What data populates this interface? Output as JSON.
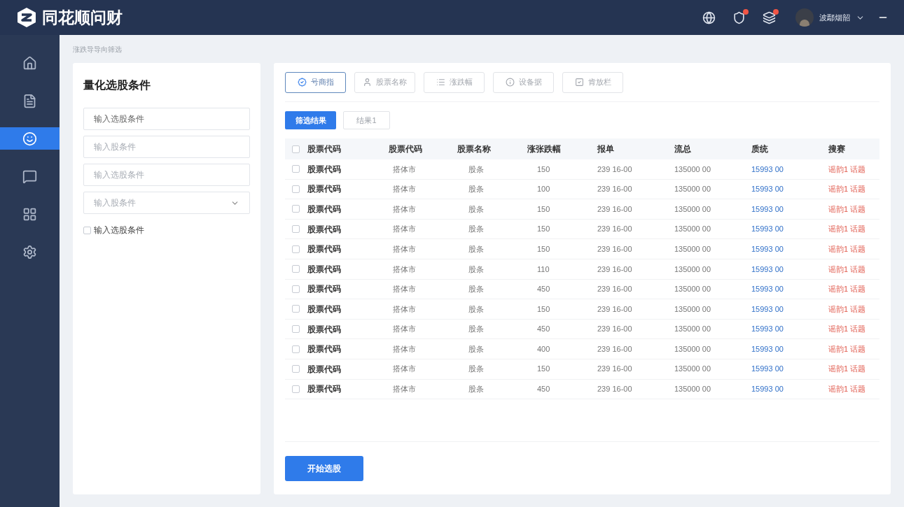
{
  "header": {
    "brand": "同花顺问财",
    "user": "波鄢烟韶",
    "notifications": [
      {
        "kind": "globe",
        "badge": false
      },
      {
        "kind": "shield",
        "badge": true
      },
      {
        "kind": "stack",
        "badge": true
      }
    ]
  },
  "sidebar": {
    "items": [
      {
        "kind": "home",
        "selected": false
      },
      {
        "kind": "document",
        "selected": false
      },
      {
        "kind": "face",
        "selected": true
      },
      {
        "kind": "chat",
        "selected": false
      },
      {
        "kind": "grid",
        "selected": false
      },
      {
        "kind": "gear",
        "selected": false
      }
    ]
  },
  "breadcrumb": "涨跌导导向筛选",
  "conditions": {
    "title": "量化选股条件",
    "fields": [
      {
        "kind": "input",
        "placeholder": "输入选股条件"
      },
      {
        "kind": "input",
        "placeholder": "输入股条件"
      },
      {
        "kind": "input",
        "placeholder": "输入选股条件"
      },
      {
        "kind": "select",
        "placeholder": "输入股条件"
      }
    ],
    "checkbox": {
      "label": "输入选股条件",
      "checked": false
    }
  },
  "tabs": [
    {
      "label": "号商指",
      "kind": "badge",
      "selected": true
    },
    {
      "label": "股票名称",
      "kind": "person",
      "selected": false
    },
    {
      "label": "涨跌幅",
      "kind": "list",
      "selected": false
    },
    {
      "label": "设备据",
      "kind": "info",
      "selected": false
    },
    {
      "label": "肯放栏",
      "kind": "check",
      "selected": false
    }
  ],
  "result_tabs": [
    {
      "label": "筛选结果",
      "selected": true
    },
    {
      "label": "结果1",
      "selected": false
    }
  ],
  "table": {
    "header_checked": false,
    "columns": [
      "股票代码",
      "股票代码",
      "股票名称",
      "涨张跌幅",
      "报单",
      "流总",
      "质统",
      "搜赛"
    ],
    "rows": [
      {
        "checked": false,
        "cells": [
          "股票代码",
          "搭体市",
          "股条",
          "150",
          "239 16-00",
          "135000 00",
          "15993 00",
          "谣韵1 话题"
        ]
      },
      {
        "checked": false,
        "cells": [
          "股票代码",
          "搭体市",
          "股条",
          "100",
          "239 16-00",
          "135000 00",
          "15993 00",
          "谣韵1 话题"
        ]
      },
      {
        "checked": false,
        "cells": [
          "股票代码",
          "搭体市",
          "股条",
          "150",
          "239 16-00",
          "135000 00",
          "15993 00",
          "谣韵1 话题"
        ]
      },
      {
        "checked": false,
        "cells": [
          "股票代码",
          "搭体市",
          "股条",
          "150",
          "239 16-00",
          "135000 00",
          "15993 00",
          "谣韵1 话题"
        ]
      },
      {
        "checked": false,
        "cells": [
          "股票代码",
          "搭体市",
          "股条",
          "150",
          "239 16-00",
          "135000 00",
          "15993 00",
          "谣韵1 话题"
        ]
      },
      {
        "checked": false,
        "cells": [
          "股票代码",
          "搭体市",
          "股条",
          "110",
          "239 16-00",
          "135000 00",
          "15993 00",
          "谣韵1 话题"
        ]
      },
      {
        "checked": false,
        "cells": [
          "股票代码",
          "搭体市",
          "股条",
          "450",
          "239 16-00",
          "135000 00",
          "15993 00",
          "谣韵1 话题"
        ]
      },
      {
        "checked": false,
        "cells": [
          "股票代码",
          "搭体市",
          "股条",
          "150",
          "239 16-00",
          "135000 00",
          "15993 00",
          "谣韵1 话题"
        ]
      },
      {
        "checked": false,
        "cells": [
          "股票代码",
          "搭体市",
          "股条",
          "450",
          "239 16-00",
          "135000 00",
          "15993 00",
          "谣韵1 话题"
        ]
      },
      {
        "checked": false,
        "cells": [
          "股票代码",
          "搭体市",
          "股条",
          "400",
          "239 16-00",
          "135000 00",
          "15993 00",
          "谣韵1 话题"
        ]
      },
      {
        "checked": false,
        "cells": [
          "股票代码",
          "搭体市",
          "股条",
          "150",
          "239 16-00",
          "135000 00",
          "15993 00",
          "谣韵1 话题"
        ]
      },
      {
        "checked": false,
        "cells": [
          "股票代码",
          "搭体市",
          "股条",
          "450",
          "239 16-00",
          "135000 00",
          "15993 00",
          "谣韵1 话题"
        ]
      }
    ]
  },
  "start_button": "开始选股"
}
